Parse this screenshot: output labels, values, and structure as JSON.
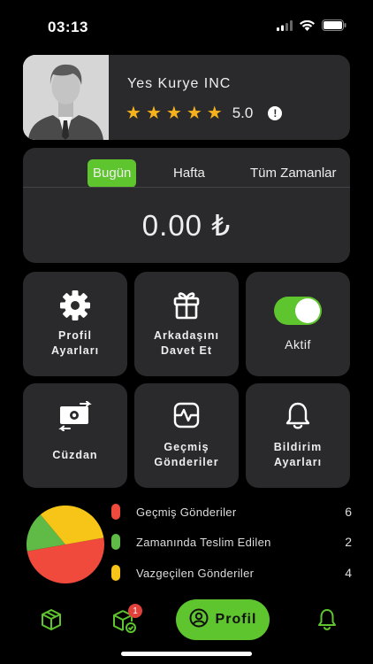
{
  "status_bar": {
    "time": "03:13"
  },
  "profile": {
    "company_name": "Yes Kurye INC",
    "stars": 5,
    "rating": "5.0",
    "info_glyph": "!"
  },
  "earnings": {
    "tabs": [
      {
        "label": "Bugün",
        "active": true
      },
      {
        "label": "Hafta",
        "active": false
      },
      {
        "label": "Tüm Zamanlar",
        "active": false
      }
    ],
    "amount": "0.00 ₺"
  },
  "tiles": {
    "profile_settings": {
      "line1": "Profil",
      "line2": "Ayarları",
      "icon": "gear-icon"
    },
    "invite_friend": {
      "line1": "Arkadaşını",
      "line2": "Davet Et",
      "icon": "gift-icon"
    },
    "status_toggle": {
      "label": "Aktif",
      "on": true
    },
    "wallet": {
      "label": "Cüzdan",
      "icon": "money-exchange-icon"
    },
    "past_deliveries": {
      "line1": "Geçmiş",
      "line2": "Gönderiler",
      "icon": "activity-monitor-icon"
    },
    "notification_settings": {
      "line1": "Bildirim",
      "line2": "Ayarları",
      "icon": "bell-icon"
    }
  },
  "chart_data": {
    "type": "pie",
    "series": [
      {
        "name": "Geçmiş Gönderiler",
        "value": 6,
        "color": "#ef4a3c"
      },
      {
        "name": "Zamanında Teslim Edilen",
        "value": 2,
        "color": "#5fba46"
      },
      {
        "name": "Vazgeçilen Gönderiler",
        "value": 4,
        "color": "#f7c418"
      }
    ]
  },
  "bottom_nav": {
    "profile_label": "Profil",
    "badge_count": "1",
    "accent": "#5fc52e"
  }
}
